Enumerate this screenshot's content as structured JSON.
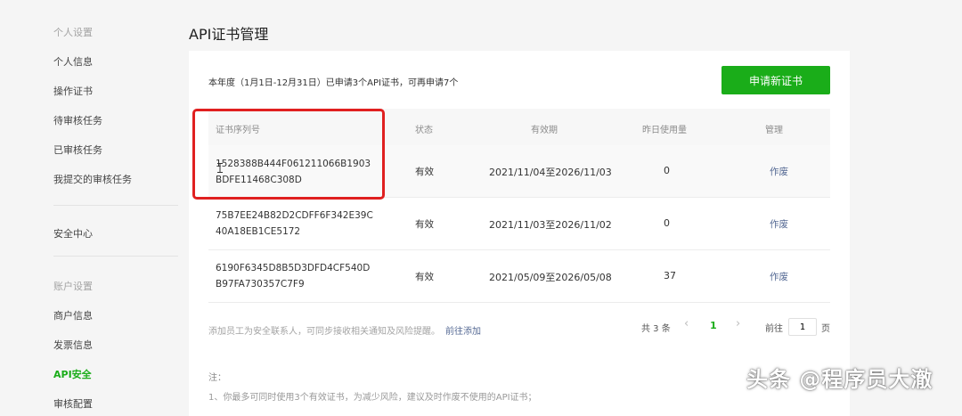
{
  "sidebar": {
    "group_personal": "个人设置",
    "items_personal": [
      "个人信息",
      "操作证书",
      "待审核任务",
      "已审核任务",
      "我提交的审核任务"
    ],
    "security_center": "安全中心",
    "group_account": "账户设置",
    "items_account": [
      "商户信息",
      "发票信息",
      "API安全",
      "审核配置"
    ],
    "active_item": "API安全"
  },
  "page": {
    "title": "API证书管理"
  },
  "summary": {
    "text": "本年度（1月1日-12月31日）已申请3个API证书，可再申请7个",
    "new_button": "申请新证书"
  },
  "table": {
    "headers": [
      "证书序列号",
      "状态",
      "有效期",
      "昨日使用量",
      "管理"
    ],
    "rows": [
      {
        "serial_line1": "1528388B444F061211066B1903",
        "serial_line2": "BDFE11468C308D",
        "status": "有效",
        "validity": "2021/11/04至2026/11/03",
        "usage": "0",
        "action": "作废"
      },
      {
        "serial_line1": "75B7EE24B82D2CDFF6F342E39C",
        "serial_line2": "40A18EB1CE5172",
        "status": "有效",
        "validity": "2021/11/03至2026/11/02",
        "usage": "0",
        "action": "作废"
      },
      {
        "serial_line1": "6190F6345D8B5D3DFD4CF540D",
        "serial_line2": "B97FA730357C7F9",
        "status": "有效",
        "validity": "2021/05/09至2026/05/08",
        "usage": "37",
        "action": "作废"
      }
    ]
  },
  "footer": {
    "note": "添加员工为安全联系人，可同步接收相关通知及风险提醒。",
    "link": "前往添加"
  },
  "pagination": {
    "total": "共 3 条",
    "prev": "‹",
    "current_page": "1",
    "next": "›",
    "goto_label": "前往",
    "goto_value": "1",
    "page_unit": "页"
  },
  "notes": {
    "title": "注：",
    "line1": "1、你最多可同时使用3个有效证书，为减少风险，建议及时作废不使用的API证书；"
  },
  "watermark": "头条 @程序员大澈",
  "colors": {
    "brand_green": "#1aad19",
    "link_blue": "#576b95",
    "highlight_red": "#e02020"
  }
}
